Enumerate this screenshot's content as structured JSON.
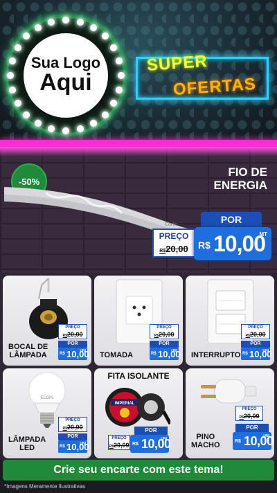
{
  "header": {
    "logo_line1": "Sua Logo",
    "logo_line2": "Aqui",
    "super": "SUPER",
    "ofertas": "OFERTAS"
  },
  "hero": {
    "discount": "-50%",
    "title_line1": "FIO DE",
    "title_line2": "ENERGIA",
    "cable_brand": "Corfio",
    "price_label": "PREÇO",
    "old_currency": "R$",
    "old_price": "20,00",
    "por": "POR",
    "new_currency": "R$",
    "new_price": "10,00",
    "unit": "MT"
  },
  "products": [
    {
      "name_line1": "BOCAL DE",
      "name_line2": "LÂMPADA",
      "price_label": "PREÇO",
      "old_currency": "R$",
      "old_price": "20,00",
      "por": "POR",
      "new_currency": "R$",
      "new_price": "10,00",
      "unit": "UNI"
    },
    {
      "name_line1": "TOMADA",
      "price_label": "PREÇO",
      "old_currency": "R$",
      "old_price": "20,00",
      "por": "POR",
      "new_currency": "R$",
      "new_price": "10,00",
      "unit": "UNI"
    },
    {
      "name_line1": "INTERRUPTOR",
      "price_label": "PREÇO",
      "old_currency": "R$",
      "old_price": "20,00",
      "por": "POR",
      "new_currency": "R$",
      "new_price": "10,00",
      "unit": "UNI"
    },
    {
      "name_line1": "LÂMPADA",
      "name_line2": "LED",
      "bulb_brand": "ELGIN",
      "price_label": "PREÇO",
      "old_currency": "R$",
      "old_price": "20,00",
      "por": "POR",
      "new_currency": "R$",
      "new_price": "10,00",
      "unit": "UNI"
    },
    {
      "name_line1": "FITA ISOLANTE",
      "tape_brand": "IMPERIAL",
      "price_label": "PREÇO",
      "old_currency": "R$",
      "old_price": "20,00",
      "por": "POR",
      "new_currency": "R$",
      "new_price": "10,00",
      "unit": "UNI"
    },
    {
      "name_line1": "PINO",
      "name_line2": "MACHO",
      "price_label": "PREÇO",
      "old_currency": "R$",
      "old_price": "20,00",
      "por": "POR",
      "new_currency": "R$",
      "new_price": "10,00",
      "unit": "UNI"
    }
  ],
  "footer": {
    "cta": "Crie seu encarte com este tema!",
    "disclaimer": "*Imagens Meramente Ilustrativas"
  },
  "colors": {
    "neon_pink": "#ff2bd6",
    "neon_blue": "#2ad0ff",
    "super_yellow": "#f4ff3a",
    "ofertas_orange": "#ffb400",
    "green": "#1e8a3a",
    "price_blue": "#1e6ee0",
    "dark_blue": "#1b4fb5"
  }
}
